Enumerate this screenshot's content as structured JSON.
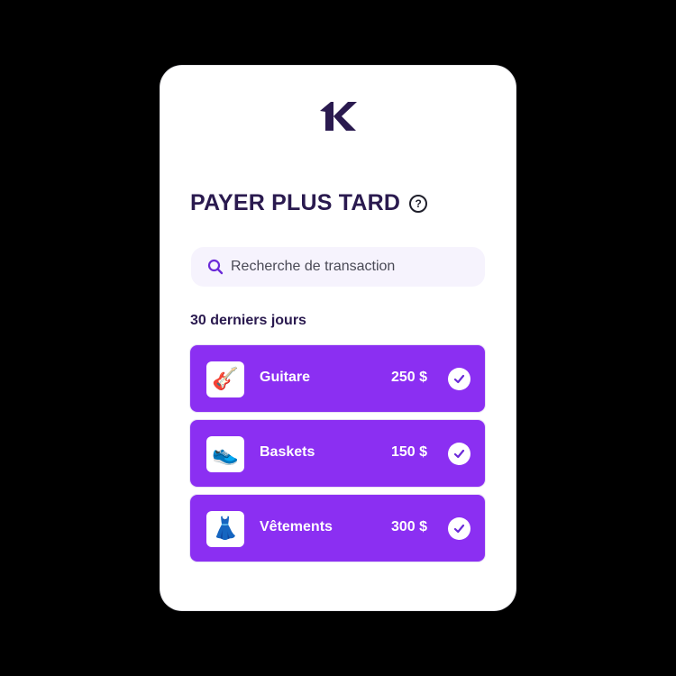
{
  "header": {
    "logo_icon": "k-logo-icon",
    "title": "PAYER PLUS TARD",
    "help_icon": "question-circle-icon",
    "help_glyph": "?"
  },
  "search": {
    "placeholder": "Recherche de transaction",
    "icon": "search-icon"
  },
  "transactions": {
    "section_label": "30 derniers jours",
    "items": [
      {
        "icon": "guitar-icon",
        "glyph": "🎸",
        "name": "Guitare",
        "amount": "250 $",
        "status_icon": "check-icon"
      },
      {
        "icon": "sneaker-icon",
        "glyph": "👟",
        "name": "Baskets",
        "amount": "150 $",
        "status_icon": "check-icon"
      },
      {
        "icon": "dress-icon",
        "glyph": "👗",
        "name": "Vêtements",
        "amount": "300 $",
        "status_icon": "check-icon"
      }
    ]
  },
  "colors": {
    "accent": "#8b2ff2",
    "brand_dark": "#2a1a4f",
    "search_bg": "#f6f3fd",
    "background": "#000000"
  }
}
